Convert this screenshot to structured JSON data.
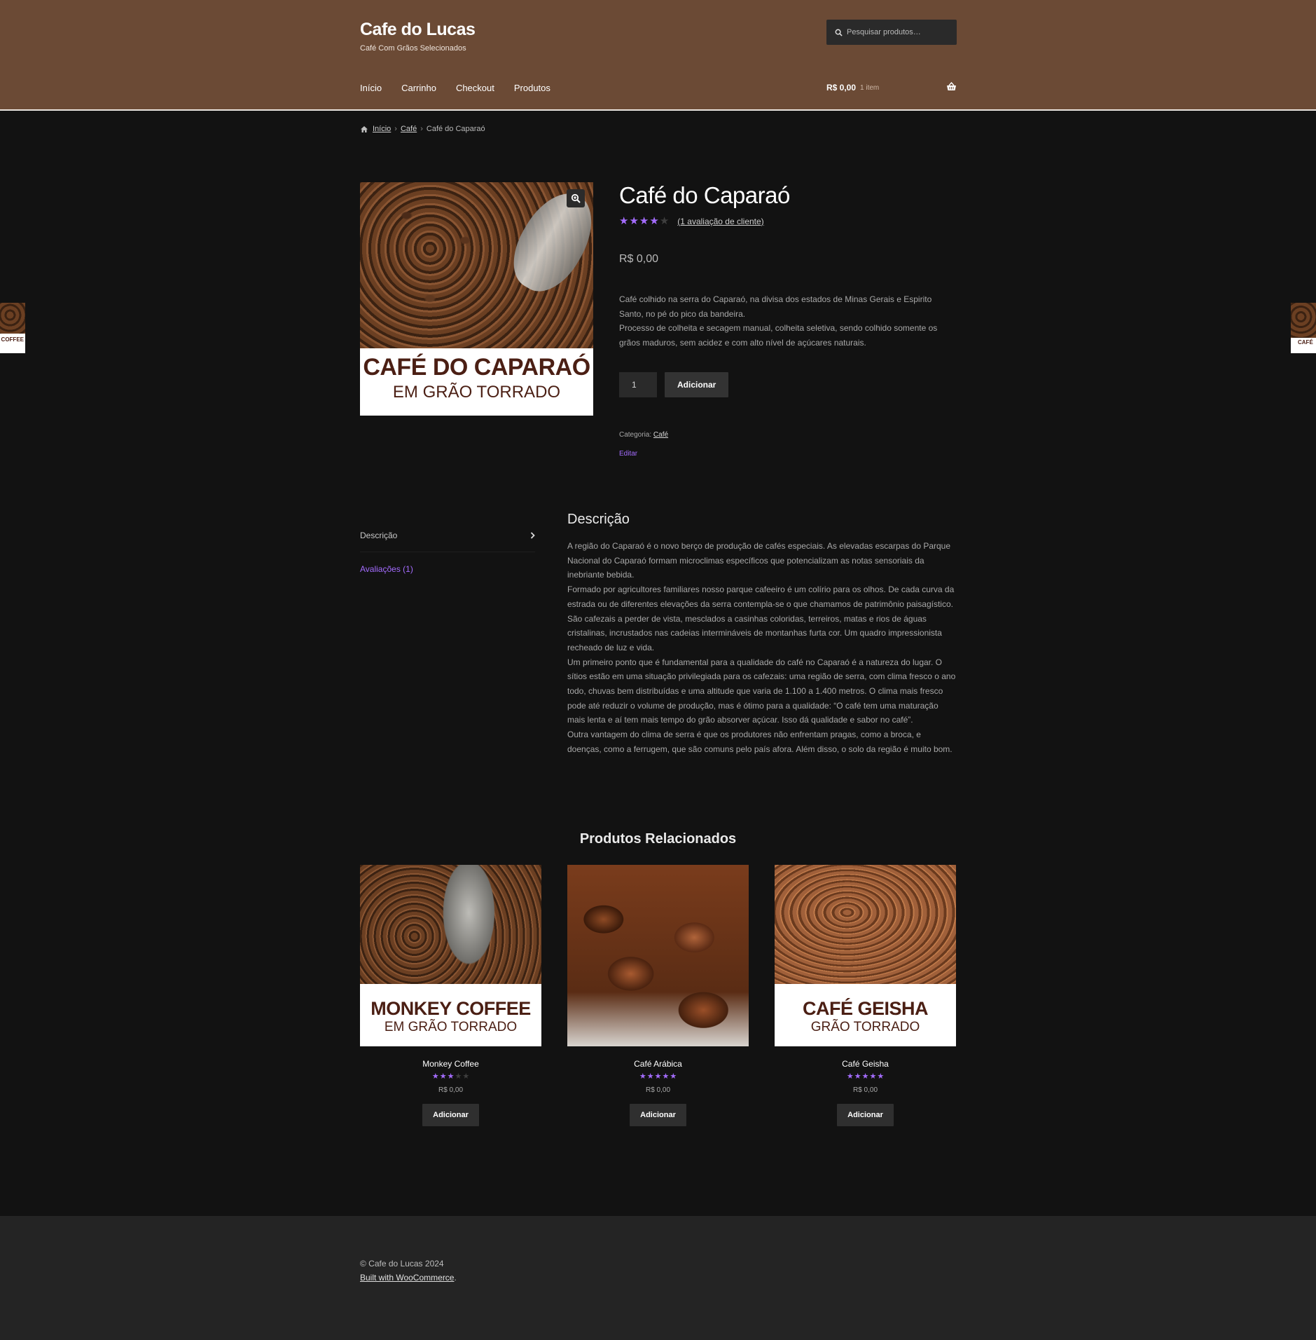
{
  "header": {
    "site_title": "Cafe do Lucas",
    "tagline": "Café Com Grãos Selecionados",
    "search_placeholder": "Pesquisar produtos…",
    "nav": [
      {
        "label": "Início"
      },
      {
        "label": "Carrinho"
      },
      {
        "label": "Checkout"
      },
      {
        "label": "Produtos"
      }
    ],
    "cart_total": "R$ 0,00",
    "cart_count": "1 item",
    "colors": {
      "header_bg": "#6b4a35",
      "accent": "#a46cff"
    }
  },
  "breadcrumb": {
    "home": "Início",
    "category": "Café",
    "current": "Café do Caparaó"
  },
  "product": {
    "image_label_title": "CAFÉ DO CAPARAÓ",
    "image_label_sub": "EM GRÃO TORRADO",
    "title": "Café do Caparaó",
    "rating": 4,
    "rating_max": 5,
    "review_link": "(1 avaliação de cliente)",
    "price": "R$ 0,00",
    "short_description": [
      "Café colhido na serra do Caparaó, na divisa dos estados de Minas Gerais e Espirito Santo, no pé do pico da bandeira.",
      "Processo de colheita e secagem manual, colheita seletiva, sendo colhido somente os grãos maduros, sem acidez e com alto nível de açúcares naturais."
    ],
    "quantity": "1",
    "add_button": "Adicionar",
    "category_label": "Categoria:",
    "category": "Café",
    "edit_link": "Editar"
  },
  "side_previews": {
    "left_label": "COFFEE",
    "right_label": "CAFÉ"
  },
  "tabs": {
    "items": [
      {
        "label": "Descrição"
      },
      {
        "label": "Avaliações (1)"
      }
    ],
    "panel_title": "Descrição",
    "panel_paragraphs": [
      "A região do Caparaó é o novo berço de produção de cafés especiais. As elevadas escarpas do Parque Nacional do Caparaó formam microclimas específicos que potencializam as notas sensoriais da inebriante bebida.",
      "Formado por agricultores familiares nosso parque cafeeiro é um colírio para os olhos. De cada curva da estrada ou de diferentes elevações da serra contempla-se o que chamamos de patrimônio paisagístico. São cafezais a perder de vista, mesclados a casinhas coloridas, terreiros, matas e rios de águas cristalinas, incrustados nas cadeias intermináveis de montanhas furta cor. Um quadro impressionista recheado de luz e vida.",
      "Um primeiro ponto que é fundamental para a qualidade do café no Caparaó é a natureza do lugar. O sítios estão em uma situação privilegiada para os cafezais: uma região de serra, com clima fresco o ano todo, chuvas bem distribuídas e uma altitude que varia de 1.100 a 1.400 metros. O clima mais fresco pode até reduzir o volume de produção, mas é ótimo para a qualidade: “O café tem uma maturação mais lenta e aí tem mais tempo do grão absorver açúcar. Isso dá qualidade e sabor no café”.",
      "Outra vantagem do clima de serra é que os produtores não enfrentam pragas, como a broca, e doenças, como a ferrugem, que são comuns pelo país afora. Além disso, o solo da região é muito bom."
    ]
  },
  "related": {
    "title": "Produtos Relacionados",
    "products": [
      {
        "name": "Monkey Coffee",
        "rating": 3,
        "price": "R$ 0,00",
        "button": "Adicionar",
        "label_title": "MONKEY COFFEE",
        "label_sub": "EM GRÃO TORRADO"
      },
      {
        "name": "Café Arábica",
        "rating": 5,
        "price": "R$ 0,00",
        "button": "Adicionar",
        "label_title": "",
        "label_sub": ""
      },
      {
        "name": "Café Geisha",
        "rating": 5,
        "price": "R$ 0,00",
        "button": "Adicionar",
        "label_title": "CAFÉ GEISHA",
        "label_sub": "GRÃO TORRADO"
      }
    ]
  },
  "footer": {
    "copyright": "© Cafe do Lucas 2024",
    "built_with": "Built with WooCommerce",
    "period": "."
  }
}
